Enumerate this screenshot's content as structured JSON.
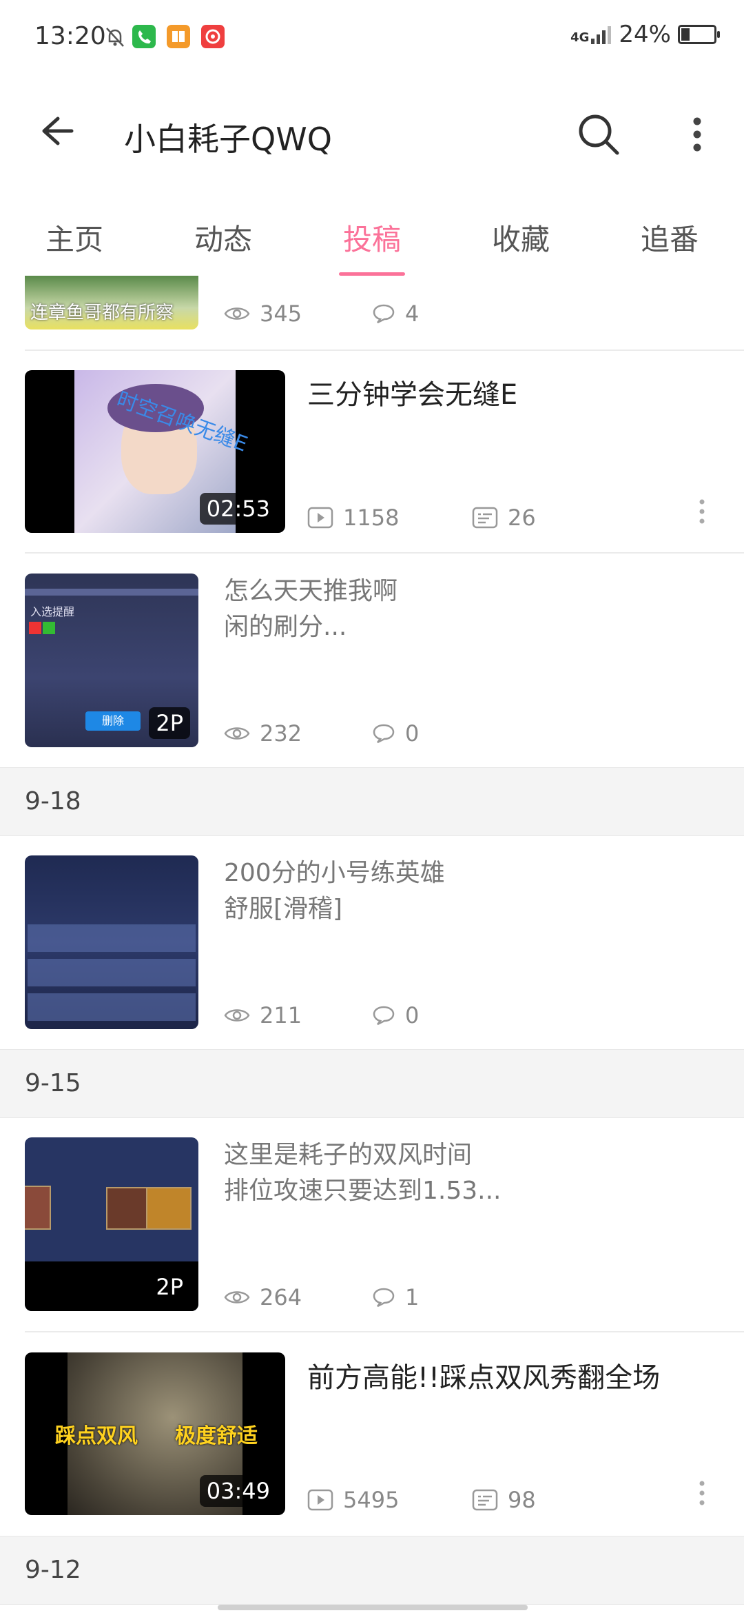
{
  "status": {
    "time": "13:20",
    "network": "4G",
    "battery": "24%"
  },
  "header": {
    "title": "小白耗子QWQ"
  },
  "tabs": [
    "主页",
    "动态",
    "投稿",
    "收藏",
    "追番"
  ],
  "items": [
    {
      "views": "345",
      "comments": "4",
      "thumb_text": "连章鱼哥都有所察"
    },
    {
      "title": "三分钟学会无缝E",
      "duration": "02:53",
      "plays": "1158",
      "danmaku": "26",
      "thumb_text": "时空召唤无缝E"
    },
    {
      "desc_line1": "怎么天天推我啊",
      "desc_line2": "闲的刷分...",
      "badge": "2P",
      "views": "232",
      "comments": "0",
      "thumb_text": "入选提醒",
      "thumb_button": "删除"
    },
    {
      "date": "9-18"
    },
    {
      "desc_line1": "200分的小号练英雄",
      "desc_line2": "舒服[滑稽]",
      "views": "211",
      "comments": "0"
    },
    {
      "date": "9-15"
    },
    {
      "desc_line1": "这里是耗子的双风时间",
      "desc_line2": "排位攻速只要达到1.53...",
      "badge": "2P",
      "views": "264",
      "comments": "1"
    },
    {
      "title": "前方高能!!踩点双风秀翻全场",
      "duration": "03:49",
      "plays": "5495",
      "danmaku": "98",
      "thumb_text_left": "踩点双风",
      "thumb_text_right": "极度舒适"
    },
    {
      "date": "9-12"
    }
  ],
  "colors": {
    "accent": "#fb7299",
    "separator": "#f4f4f4"
  },
  "icons": [
    "mute-bell-icon",
    "phone-icon",
    "book-icon",
    "record-icon",
    "signal-icon",
    "battery-icon",
    "back-arrow-icon",
    "search-icon",
    "more-vertical-icon",
    "eye-icon",
    "comment-icon",
    "play-icon",
    "danmaku-icon"
  ]
}
